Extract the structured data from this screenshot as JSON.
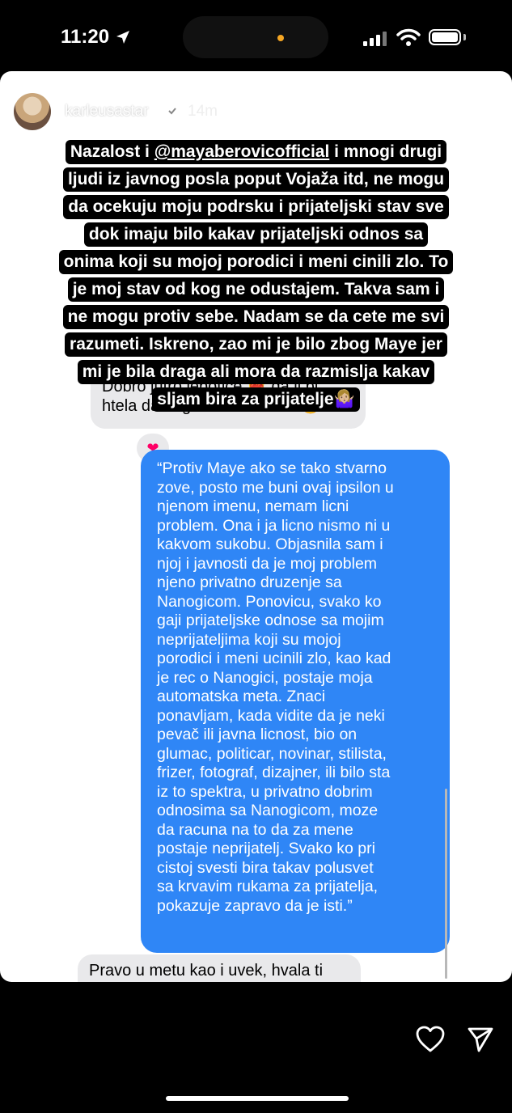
{
  "status_bar": {
    "time": "11:20"
  },
  "story_header": {
    "username": "karleusastar",
    "time_ago": "14m",
    "more_label": "•••"
  },
  "caption": {
    "lines": [
      "Nazalost i @mayaberovicofficial i mnogi drugi",
      "ljudi iz javnog posla poput Vojaža itd, ne mogu",
      "da ocekuju moju podrsku i prijateljski stav sve",
      "dok imaju bilo kakav prijateljski odnos sa",
      "onima koji su mojoj porodici i meni cinili zlo. To",
      "je moj stav od kog ne odustajem. Takva sam i",
      "ne mogu protiv sebe. Nadam se da cete me svi",
      "razumeti. Iskreno, zao mi je bilo zbog Maye jer",
      "mi je bila draga ali mora da razmislja kakav",
      "sljam bira za prijatelje🤷🏼‍♀️"
    ],
    "mention": "@mayaberovicofficial"
  },
  "chat": {
    "first_message_lines": [
      "Dobro jutro lepotice ❤️‍🔥 da li bi",
      "htela da odgovoriš na ovo? 😂"
    ],
    "reaction": "❤",
    "reply_lines": [
      "“Protiv Maye ako se tako stvarno",
      "zove, posto me buni ovaj ipsilon u",
      "njenom imenu, nemam licni",
      "problem. Ona i ja licno nismo ni u",
      "kakvom sukobu. Objasnila sam i",
      "njoj i javnosti da je moj problem",
      "njeno privatno druzenje sa",
      "Nanogicom. Ponovicu, svako ko",
      "gaji prijateljske odnose sa mojim",
      "neprijateljima koji su mojoj",
      "porodici i meni ucinili zlo, kao kad",
      "je rec o Nanogici, postaje moja",
      "automatska meta. Znaci",
      "ponavljam, kada vidite da je neki",
      "pevač ili javna licnost, bio on",
      "glumac, politicar, novinar, stilista,",
      "frizer, fotograf, dizajner, ili bilo sta",
      "iz to spektra, u privatno dobrim",
      "odnosima sa Nanogicom, moze",
      "da racuna na to da za mene",
      "postaje neprijatelj. Svako ko pri",
      "cistoj svesti bira takav polusvet",
      "sa krvavim rukama za prijatelja,",
      "pokazuje zapravo da je isti.”"
    ],
    "last_message_line": "Pravo u metu kao i uvek, hvala ti"
  },
  "colors": {
    "blue_bubble": "#2f86f6",
    "gray_bubble": "#e9e9eb"
  },
  "icons": [
    "location-arrow-icon",
    "signal-icon",
    "wifi-icon",
    "battery-icon",
    "verified-icon",
    "more-icon",
    "close-icon",
    "heart-icon",
    "send-icon"
  ]
}
